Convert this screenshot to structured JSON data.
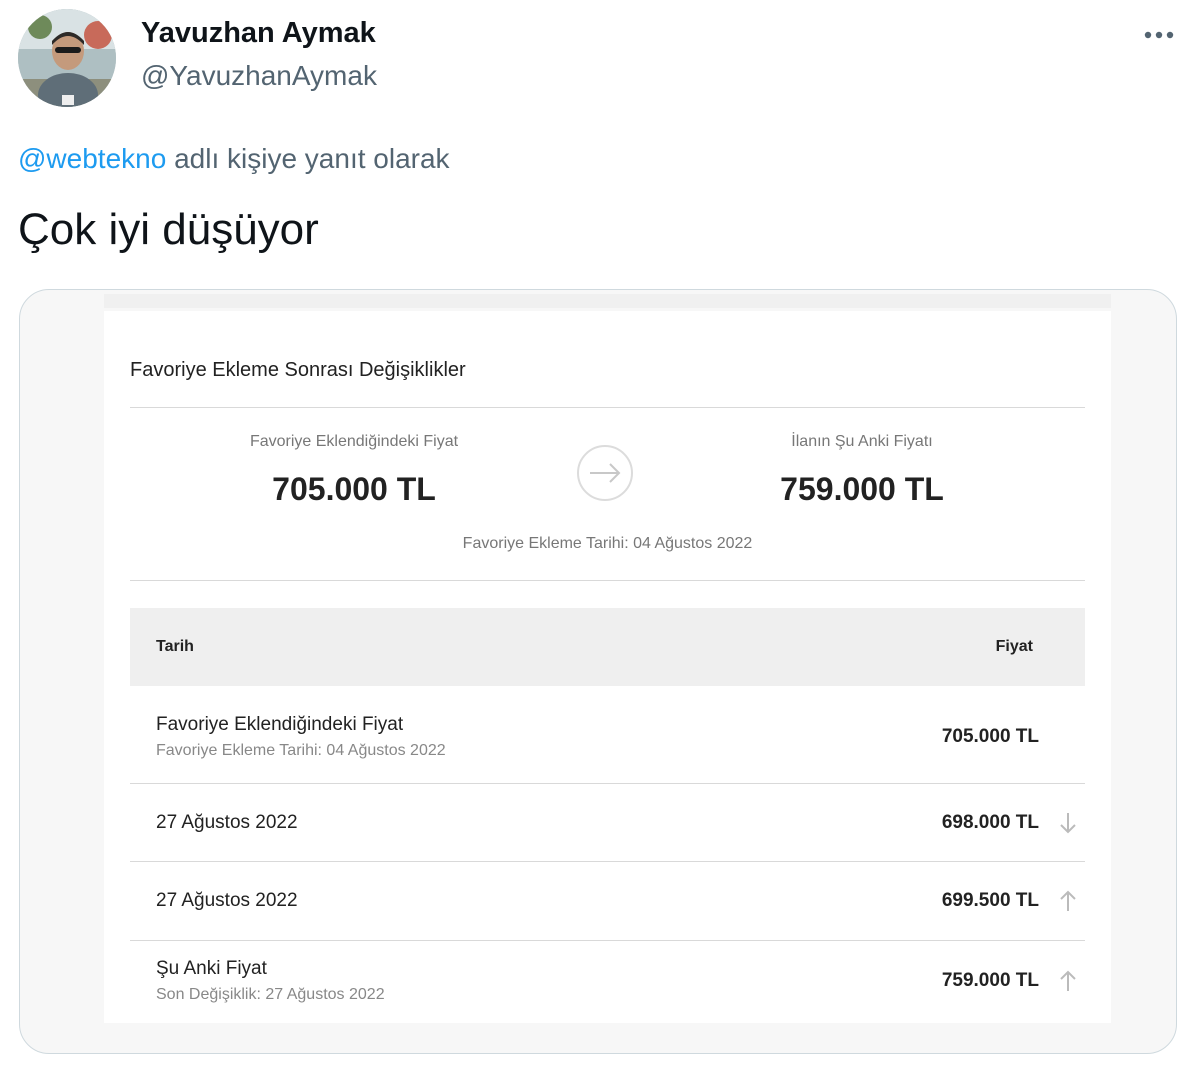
{
  "author": {
    "name": "Yavuzhan Aymak",
    "handle": "@YavuzhanAymak"
  },
  "more_icon": "more-horizontal-icon",
  "reply": {
    "mention": "@webtekno",
    "suffix": " adlı kişiye yanıt olarak"
  },
  "tweet_text": "Çok iyi düşüyor",
  "screenshot": {
    "title": "Favoriye Ekleme Sonrası Değişiklikler",
    "added_price_label": "Favoriye Eklendiğindeki Fiyat",
    "added_price": "705.000 TL",
    "current_price_label": "İlanın Şu Anki Fiyatı",
    "current_price": "759.000 TL",
    "arrow_icon": "arrow-right-icon",
    "added_date_note": "Favoriye Ekleme Tarihi: 04 Ağustos 2022",
    "table": {
      "headers": {
        "date": "Tarih",
        "price": "Fiyat"
      },
      "rows": [
        {
          "main": "Favoriye Eklendiğindeki Fiyat",
          "sub": "Favoriye Ekleme Tarihi: 04 Ağustos 2022",
          "price": "705.000 TL",
          "trend": ""
        },
        {
          "main": "27 Ağustos 2022",
          "sub": "",
          "price": "698.000 TL",
          "trend": "down"
        },
        {
          "main": "27 Ağustos 2022",
          "sub": "",
          "price": "699.500 TL",
          "trend": "up"
        },
        {
          "main": "Şu Anki Fiyat",
          "sub": "Son Değişiklik: 27 Ağustos 2022",
          "price": "759.000 TL",
          "trend": "up"
        }
      ]
    }
  },
  "colors": {
    "link": "#1d9bf0",
    "secondary_text": "#536471",
    "card_border": "#cfd9de"
  }
}
